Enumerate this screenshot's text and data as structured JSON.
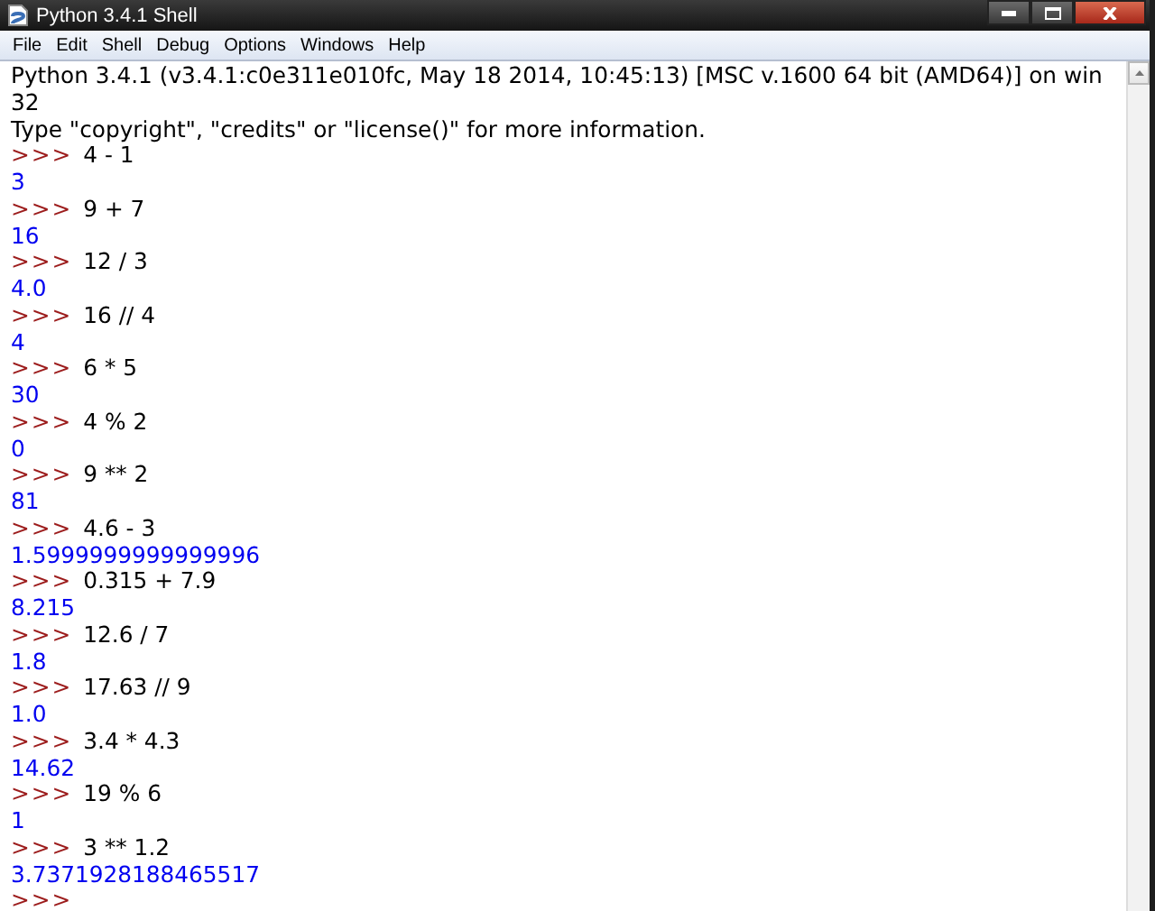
{
  "window": {
    "title": "Python 3.4.1 Shell"
  },
  "menu": [
    "File",
    "Edit",
    "Shell",
    "Debug",
    "Options",
    "Windows",
    "Help"
  ],
  "lines": [
    {
      "kind": "info",
      "text": "Python 3.4.1 (v3.4.1:c0e311e010fc, May 18 2014, 10:45:13) [MSC v.1600 64 bit (AMD64)] on win"
    },
    {
      "kind": "info",
      "text": "32"
    },
    {
      "kind": "info",
      "text": "Type \"copyright\", \"credits\" or \"license()\" for more information."
    },
    {
      "kind": "prompt",
      "prompt": ">>>",
      "text": "4 - 1"
    },
    {
      "kind": "output",
      "text": "3"
    },
    {
      "kind": "prompt",
      "prompt": ">>>",
      "text": "9 + 7"
    },
    {
      "kind": "output",
      "text": "16"
    },
    {
      "kind": "prompt",
      "prompt": ">>>",
      "text": "12 / 3"
    },
    {
      "kind": "output",
      "text": "4.0"
    },
    {
      "kind": "prompt",
      "prompt": ">>>",
      "text": "16 // 4"
    },
    {
      "kind": "output",
      "text": "4"
    },
    {
      "kind": "prompt",
      "prompt": ">>>",
      "text": "6 * 5"
    },
    {
      "kind": "output",
      "text": "30"
    },
    {
      "kind": "prompt",
      "prompt": ">>>",
      "text": "4 % 2"
    },
    {
      "kind": "output",
      "text": "0"
    },
    {
      "kind": "prompt",
      "prompt": ">>>",
      "text": "9 ** 2"
    },
    {
      "kind": "output",
      "text": "81"
    },
    {
      "kind": "prompt",
      "prompt": ">>>",
      "text": "4.6 - 3"
    },
    {
      "kind": "output",
      "text": "1.5999999999999996"
    },
    {
      "kind": "prompt",
      "prompt": ">>>",
      "text": "0.315 + 7.9"
    },
    {
      "kind": "output",
      "text": "8.215"
    },
    {
      "kind": "prompt",
      "prompt": ">>>",
      "text": "12.6 / 7"
    },
    {
      "kind": "output",
      "text": "1.8"
    },
    {
      "kind": "prompt",
      "prompt": ">>>",
      "text": "17.63 // 9"
    },
    {
      "kind": "output",
      "text": "1.0"
    },
    {
      "kind": "prompt",
      "prompt": ">>>",
      "text": "3.4 * 4.3"
    },
    {
      "kind": "output",
      "text": "14.62"
    },
    {
      "kind": "prompt",
      "prompt": ">>>",
      "text": "19 % 6"
    },
    {
      "kind": "output",
      "text": "1"
    },
    {
      "kind": "prompt",
      "prompt": ">>>",
      "text": "3 ** 1.2"
    },
    {
      "kind": "output",
      "text": "3.7371928188465517"
    },
    {
      "kind": "prompt",
      "prompt": ">>>"
    }
  ]
}
